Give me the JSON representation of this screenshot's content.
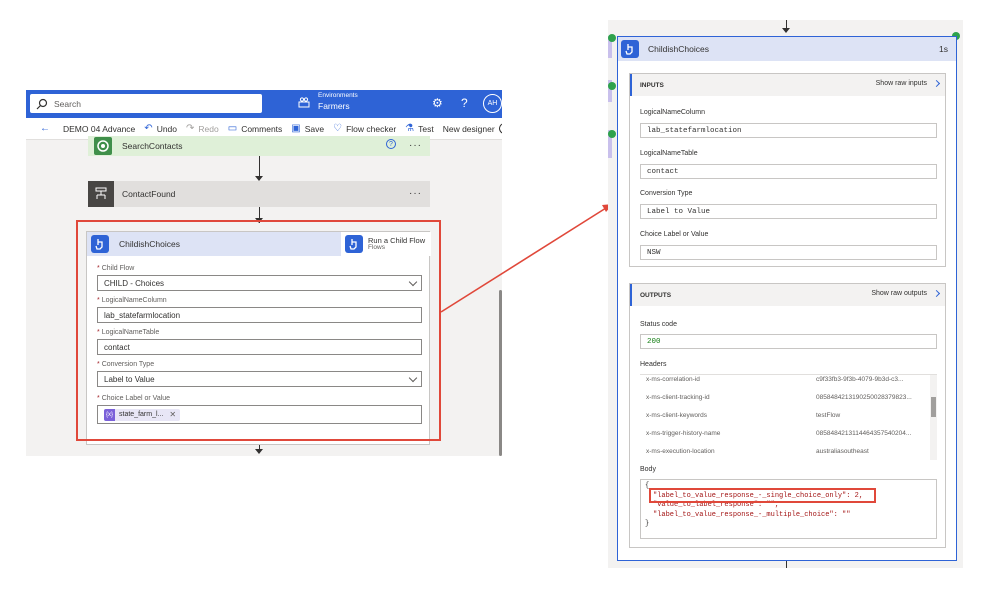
{
  "left": {
    "topbar": {
      "search_placeholder": "Search",
      "env_small": "Environments",
      "env_name": "Farmers",
      "settings_icon": "gear-icon",
      "help_icon": "question-icon",
      "avatar": "AH"
    },
    "cmdbar": {
      "back_icon": "back-arrow-icon",
      "flow_name": "DEMO 04 Advance",
      "undo": "Undo",
      "redo": "Redo",
      "comments": "Comments",
      "save": "Save",
      "flow_checker": "Flow checker",
      "test": "Test",
      "new_designer": "New designer"
    },
    "cards": {
      "search_contacts": "SearchContacts",
      "search_contacts_help": "?",
      "contact_found": "ContactFound",
      "more": "···"
    },
    "child_action": {
      "title": "ChildishChoices",
      "run_child_title": "Run a Child Flow",
      "run_child_sub": "Flows",
      "fields": [
        {
          "label": "Child Flow",
          "value": "CHILD - Choices"
        },
        {
          "label": "LogicalNameColumn",
          "value": "lab_statefarmlocation"
        },
        {
          "label": "LogicalNameTable",
          "value": "contact"
        },
        {
          "label": "Conversion Type",
          "value": "Label to Value"
        },
        {
          "label": "Choice Label or Value",
          "value": "state_farm_l..."
        }
      ],
      "required_mark": "*",
      "token_icon": "{x}",
      "token_remove": "✕"
    }
  },
  "right": {
    "title": "ChildishChoices",
    "duration": "1s",
    "inputs": {
      "header": "INPUTS",
      "raw_link": "Show raw inputs",
      "fields": [
        {
          "label": "LogicalNameColumn",
          "value": "lab_statefarmlocation"
        },
        {
          "label": "LogicalNameTable",
          "value": "contact"
        },
        {
          "label": "Conversion Type",
          "value": "Label to Value"
        },
        {
          "label": "Choice Label or Value",
          "value": "NSW"
        }
      ]
    },
    "outputs": {
      "header": "OUTPUTS",
      "raw_link": "Show raw outputs",
      "status_label": "Status code",
      "status_value": "200",
      "headers_label": "Headers",
      "headers": [
        {
          "k": "x-ms-correlation-id",
          "v": "c9f33fb3-9f3b-4079-9b3d-c3..."
        },
        {
          "k": "x-ms-client-tracking-id",
          "v": "0858484213190250028379823..."
        },
        {
          "k": "x-ms-client-keywords",
          "v": "testFlow"
        },
        {
          "k": "x-ms-trigger-history-name",
          "v": "0858484213114464357540204..."
        },
        {
          "k": "x-ms-execution-location",
          "v": "australiasoutheast"
        }
      ],
      "body_label": "Body",
      "body_open": "{",
      "body_lines": [
        "\"label_to_value_response_-_single_choice_only\": 2,",
        "\"value_to_label_response\": \"\",",
        "\"label_to_value_response_-_multiple_choice\": \"\""
      ],
      "body_close": "}"
    }
  },
  "colors": {
    "brand_blue": "#2e63d6",
    "highlight_red": "#e0483a",
    "success_green": "#2ea24c"
  }
}
